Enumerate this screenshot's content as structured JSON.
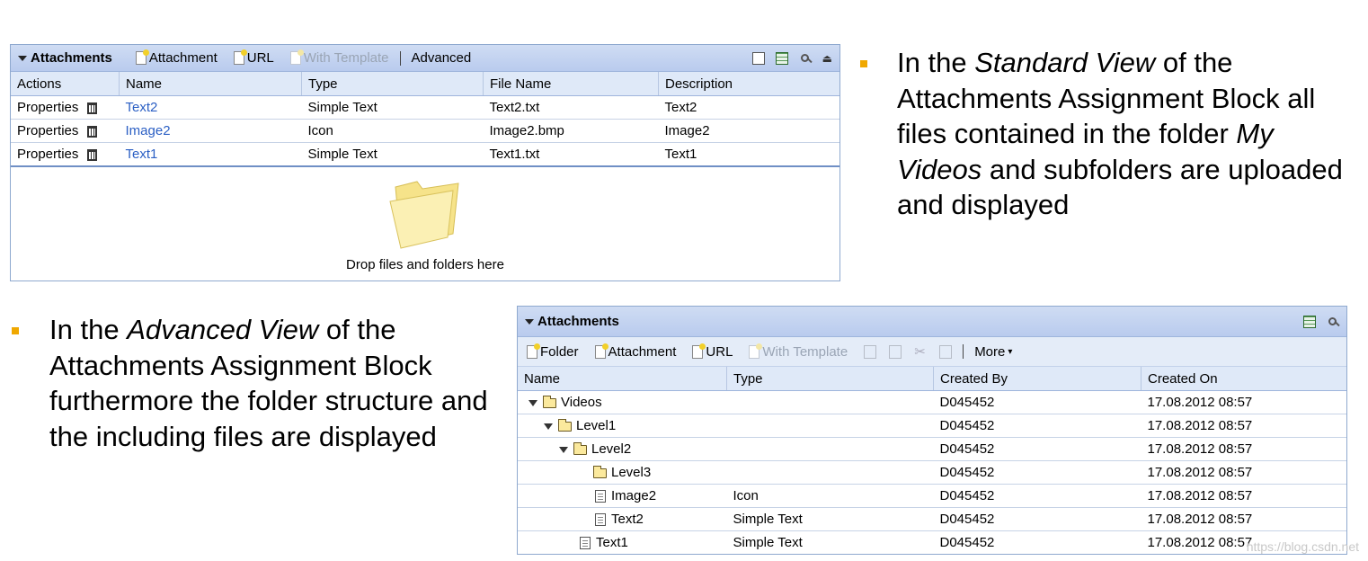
{
  "standard_block": {
    "title": "Attachments",
    "toolbar": {
      "attachment": "Attachment",
      "url": "URL",
      "with_template": "With Template",
      "advanced": "Advanced"
    },
    "columns": [
      "Actions",
      "Name",
      "Type",
      "File Name",
      "Description"
    ],
    "rows": [
      {
        "action": "Properties",
        "name": "Text2",
        "type": "Simple Text",
        "file_name": "Text2.txt",
        "description": "Text2"
      },
      {
        "action": "Properties",
        "name": "Image2",
        "type": "Icon",
        "file_name": "Image2.bmp",
        "description": "Image2"
      },
      {
        "action": "Properties",
        "name": "Text1",
        "type": "Simple Text",
        "file_name": "Text1.txt",
        "description": "Text1"
      }
    ],
    "drop_text": "Drop files and folders here"
  },
  "advanced_block": {
    "title": "Attachments",
    "toolbar": {
      "folder": "Folder",
      "attachment": "Attachment",
      "url": "URL",
      "with_template": "With Template",
      "more": "More"
    },
    "columns": [
      "Name",
      "Type",
      "Created By",
      "Created On"
    ],
    "rows": [
      {
        "name": "Videos",
        "type": "",
        "created_by": "D045452",
        "created_on": "17.08.2012 08:57"
      },
      {
        "name": "Level1",
        "type": "",
        "created_by": "D045452",
        "created_on": "17.08.2012 08:57"
      },
      {
        "name": "Level2",
        "type": "",
        "created_by": "D045452",
        "created_on": "17.08.2012 08:57"
      },
      {
        "name": "Level3",
        "type": "",
        "created_by": "D045452",
        "created_on": "17.08.2012 08:57"
      },
      {
        "name": "Image2",
        "type": "Icon",
        "created_by": "D045452",
        "created_on": "17.08.2012 08:57"
      },
      {
        "name": "Text2",
        "type": "Simple Text",
        "created_by": "D045452",
        "created_on": "17.08.2012 08:57"
      },
      {
        "name": "Text1",
        "type": "Simple Text",
        "created_by": "D045452",
        "created_on": "17.08.2012 08:57"
      }
    ]
  },
  "notes": {
    "standard": [
      "In the ",
      "Standard View",
      " of the Attachments Assignment Block all files contained in the folder ",
      "My Videos",
      " and subfolders are uploaded and displayed"
    ],
    "advanced": [
      "In the ",
      "Advanced View",
      " of the Attachments Assignment Block furthermore the folder structure and the including files are displayed"
    ]
  },
  "watermark": "https://blog.csdn.net",
  "colors": {
    "link": "#2b5fc4",
    "header_bg": "#c6d6f1",
    "bullet": "#f0a800"
  }
}
